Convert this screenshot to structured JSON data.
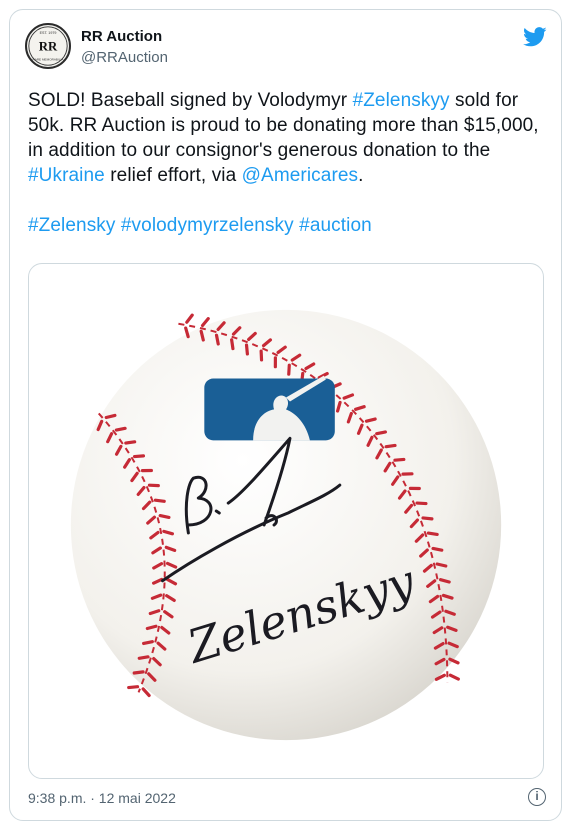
{
  "account": {
    "name": "RR Auction",
    "handle": "@RRAuction",
    "avatar_text": "RR",
    "avatar_est": "EST. 1979",
    "avatar_ring": "RARE MEMORABILIA"
  },
  "tweet": {
    "t1": "SOLD! Baseball signed by Volodymyr ",
    "h1": "#Zelenskyy",
    "t2": " sold for 50k. RR Auction is proud to be donating more than $15,000, in addition to our consignor's generous donation to the ",
    "h2": "#Ukraine",
    "t3": " relief effort, via ",
    "m1": "@Americares",
    "t4": ".",
    "tags": [
      "#Zelensky",
      "#volodymyrzelensky",
      "#auction"
    ]
  },
  "media": {
    "signature_line1": "B. Ze",
    "signature_line2": "Zelenskyy"
  },
  "timestamp": "9:38 p.m. · 12 mai 2022",
  "colors": {
    "link": "#1d9bf0",
    "muted": "#536471",
    "border": "#cfd9de",
    "stitch": "#c62a36",
    "logo": "#1a5f96"
  },
  "icons": {
    "brand": "twitter-bird-icon",
    "info": "info-icon"
  }
}
